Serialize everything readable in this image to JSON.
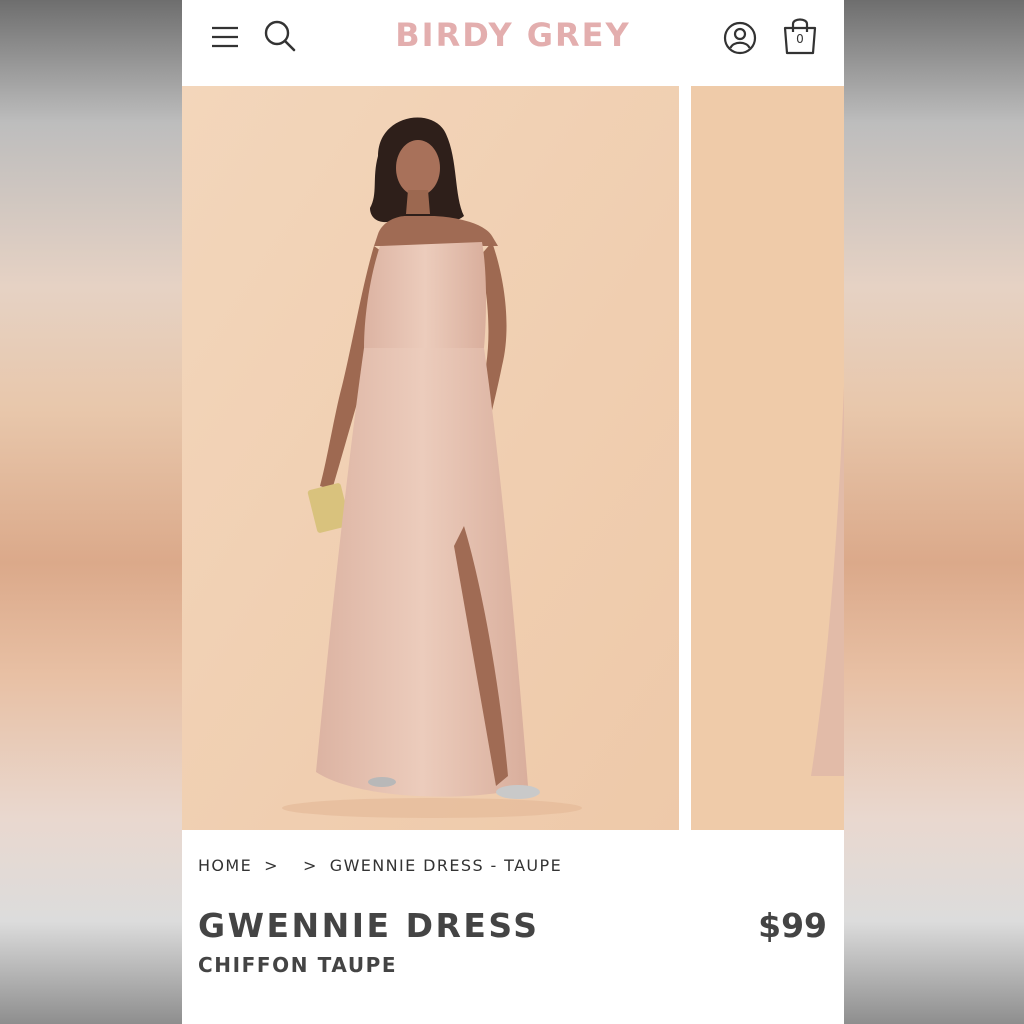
{
  "header": {
    "brand": "BIRDY GREY",
    "cart_count": "0",
    "icons": [
      "hamburger-menu-icon",
      "search-icon",
      "account-icon",
      "shopping-bag-icon"
    ]
  },
  "gallery": {
    "background_color": "#f1d2b4",
    "dress_color": "#e9c7b6"
  },
  "breadcrumb": {
    "home": "HOME",
    "sep1": ">",
    "sep2": ">",
    "current": "GWENNIE DRESS - TAUPE"
  },
  "product": {
    "name": "GWENNIE DRESS",
    "variant": "CHIFFON TAUPE",
    "price": "$99"
  },
  "colors": {
    "brand": "#e3aeae",
    "text": "#444444"
  }
}
